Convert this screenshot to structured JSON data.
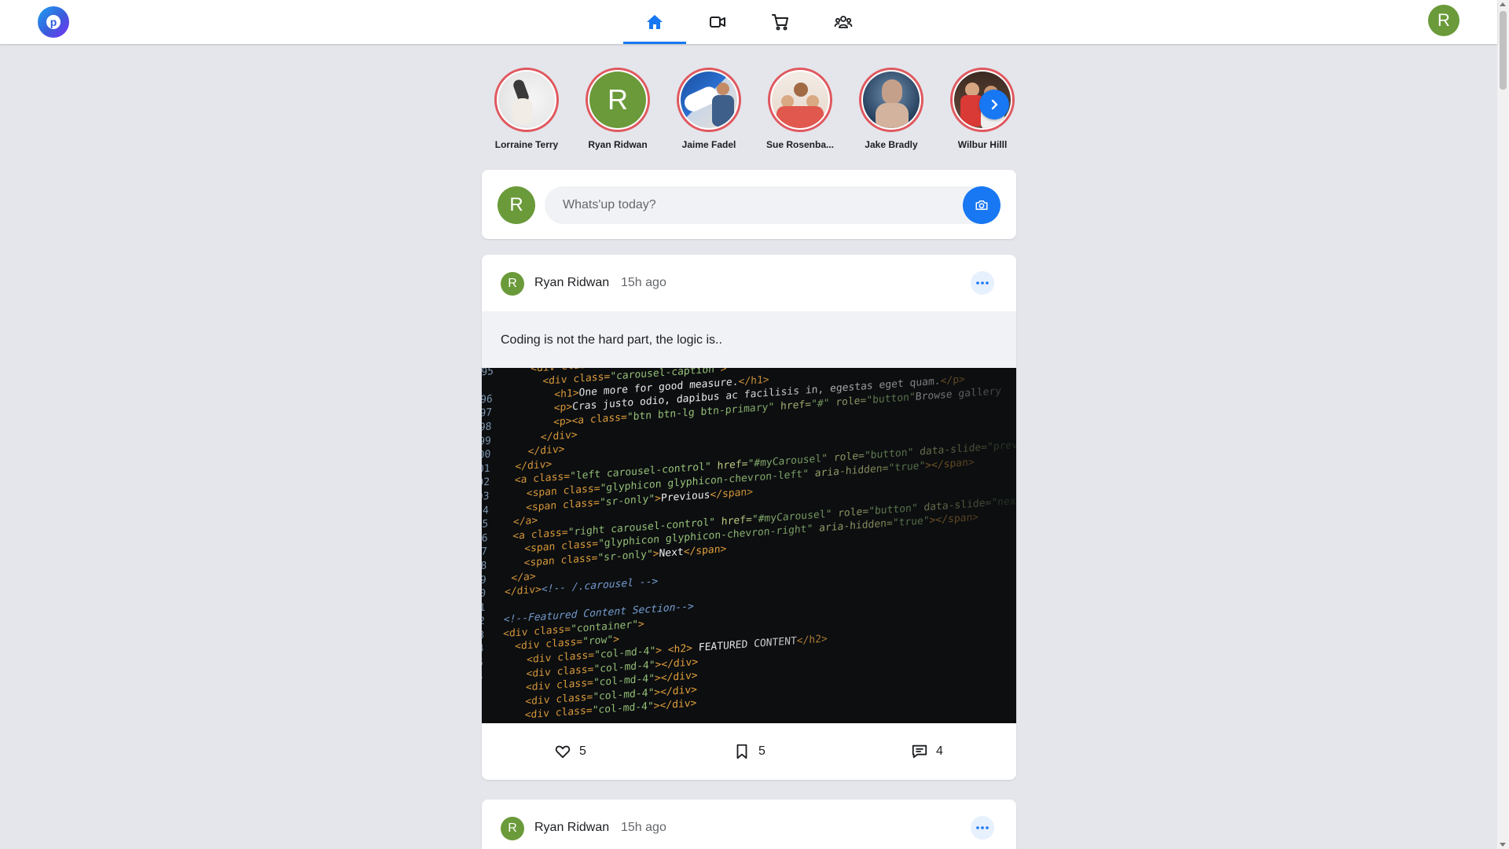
{
  "colors": {
    "accent": "#1877f2",
    "avatar_green": "#6a9a3a",
    "story_ring": "#e0585f",
    "background": "#e4e6eb"
  },
  "topbar": {
    "logo_letter": "p",
    "tabs": [
      {
        "icon": "home-icon",
        "active": true
      },
      {
        "icon": "video-icon",
        "active": false
      },
      {
        "icon": "cart-icon",
        "active": false
      },
      {
        "icon": "groups-icon",
        "active": false
      }
    ],
    "user_initial": "R"
  },
  "stories": [
    {
      "name": "Lorraine Terry"
    },
    {
      "name": "Ryan Ridwan",
      "initial": "R"
    },
    {
      "name": "Jaime Fadel"
    },
    {
      "name": "Sue Rosenba..."
    },
    {
      "name": "Jake Bradly"
    },
    {
      "name": "Wilbur Hilll"
    }
  ],
  "composer": {
    "user_initial": "R",
    "placeholder": "Whats'up today?"
  },
  "posts": [
    {
      "author": "Ryan Ridwan",
      "initial": "R",
      "time": "15h ago",
      "text": "Coding is not the hard part, the logic is..",
      "likes": "5",
      "saves": "5",
      "comments": "4"
    },
    {
      "author": "Ryan Ridwan",
      "initial": "R",
      "time": "15h ago"
    }
  ]
}
